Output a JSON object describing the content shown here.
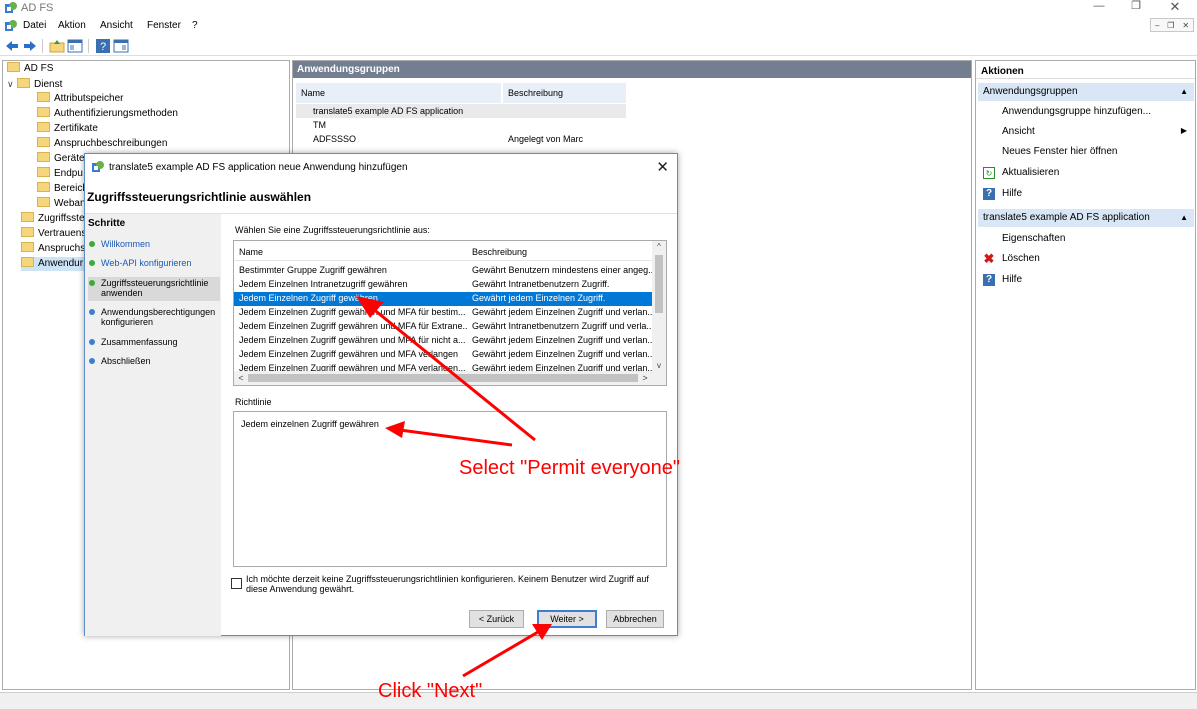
{
  "window": {
    "title": "AD FS"
  },
  "menu": [
    "Datei",
    "Aktion",
    "Ansicht",
    "Fenster",
    "?"
  ],
  "tree": {
    "root": "AD FS",
    "items": [
      {
        "label": "Dienst",
        "level": 1,
        "expanded": true
      },
      {
        "label": "Attributspeicher",
        "level": 2
      },
      {
        "label": "Authentifizierungsmethoden",
        "level": 2
      },
      {
        "label": "Zertifikate",
        "level": 2
      },
      {
        "label": "Anspruchbeschreibungen",
        "level": 2
      },
      {
        "label": "Geräte",
        "level": 2
      },
      {
        "label": "Endpu",
        "level": 2
      },
      {
        "label": "Bereich",
        "level": 2
      },
      {
        "label": "Weban",
        "level": 2
      },
      {
        "label": "Zugriffsste",
        "level": 1
      },
      {
        "label": "Vertrauens",
        "level": 1
      },
      {
        "label": "Anspruchs",
        "level": 1
      },
      {
        "label": "Anwendur",
        "level": 1,
        "selected": true
      }
    ]
  },
  "middle": {
    "header": "Anwendungsgruppen",
    "columns": [
      "Name",
      "Beschreibung"
    ],
    "rows": [
      {
        "name": "translate5 example AD FS application",
        "desc": ""
      },
      {
        "name": "TM",
        "desc": ""
      },
      {
        "name": "ADFSSSO",
        "desc": "Angelegt von Marc"
      }
    ]
  },
  "actions": {
    "title": "Aktionen",
    "section1": "Anwendungsgruppen",
    "section1_items": [
      "Anwendungsgruppe hinzufügen...",
      "Ansicht",
      "Neues Fenster hier öffnen",
      "Aktualisieren",
      "Hilfe"
    ],
    "section2": "translate5 example AD FS application",
    "section2_items": [
      "Eigenschaften",
      "Löschen",
      "Hilfe"
    ]
  },
  "dialog": {
    "title": "translate5 example AD FS application neue Anwendung hinzufügen",
    "heading": "Zugriffssteuerungsrichtlinie auswählen",
    "steps_title": "Schritte",
    "steps": [
      {
        "label": "Willkommen",
        "state": "done"
      },
      {
        "label": "Web-API konfigurieren",
        "state": "done"
      },
      {
        "label": "Zugriffssteuerungsrichtlinie anwenden",
        "state": "current"
      },
      {
        "label": "Anwendungsberechtigungen konfigurieren",
        "state": "todo"
      },
      {
        "label": "Zusammenfassung",
        "state": "todo"
      },
      {
        "label": "Abschließen",
        "state": "todo"
      }
    ],
    "select_label": "Wählen Sie eine Zugriffssteuerungsrichtlinie aus:",
    "list_columns": [
      "Name",
      "Beschreibung"
    ],
    "policies": [
      {
        "name": "Bestimmter Gruppe Zugriff gewähren",
        "desc": "Gewährt Benutzern mindestens einer angeg..."
      },
      {
        "name": "Jedem Einzelnen Intranetzugriff gewähren",
        "desc": "Gewährt Intranetbenutzern Zugriff."
      },
      {
        "name": "Jedem Einzelnen Zugriff gewähren",
        "desc": "Gewährt jedem Einzelnen Zugriff.",
        "selected": true
      },
      {
        "name": "Jedem Einzelnen Zugriff gewähren und MFA für bestim...",
        "desc": "Gewährt jedem Einzelnen Zugriff und verlan..."
      },
      {
        "name": "Jedem Einzelnen Zugriff gewähren und MFA für Extrane...",
        "desc": "Gewährt Intranetbenutzern Zugriff und verla..."
      },
      {
        "name": "Jedem Einzelnen Zugriff gewähren und MFA für nicht a...",
        "desc": "Gewährt jedem Einzelnen Zugriff und verlan..."
      },
      {
        "name": "Jedem Einzelnen Zugriff gewähren und MFA verlangen",
        "desc": "Gewährt jedem Einzelnen Zugriff und verlan..."
      },
      {
        "name": "Jedem Einzelnen Zugriff gewähren und MFA verlangen...",
        "desc": "Gewährt jedem Einzelnen Zugriff und verlan..."
      }
    ],
    "policy_label": "Richtlinie",
    "policy_text": "Jedem einzelnen  Zugriff gewähren",
    "checkbox_label": "Ich möchte derzeit keine Zugriffssteuerungsrichtlinien konfigurieren. Keinem Benutzer wird Zugriff auf diese Anwendung gewährt.",
    "checkbox_checked": false,
    "buttons": {
      "back": "< Zurück",
      "next": "Weiter >",
      "cancel": "Abbrechen"
    }
  },
  "annotations": {
    "select": "Select \"Permit everyone\"",
    "next": "Click \"Next\""
  },
  "colors": {
    "selection": "#0078d7",
    "annotation": "#ff0000",
    "header": "#737f91"
  }
}
